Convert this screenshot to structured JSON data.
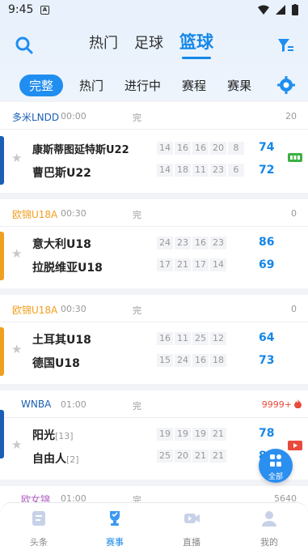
{
  "status_bar": {
    "time": "9:45",
    "sim_label": "A"
  },
  "header": {
    "main_tabs": [
      {
        "label": "热门",
        "active": false
      },
      {
        "label": "足球",
        "active": false
      },
      {
        "label": "篮球",
        "active": true
      }
    ],
    "sub_tabs": [
      {
        "label": "完整",
        "active": true
      },
      {
        "label": "热门",
        "active": false
      },
      {
        "label": "进行中",
        "active": false
      },
      {
        "label": "赛程",
        "active": false
      },
      {
        "label": "赛果",
        "active": false
      }
    ]
  },
  "matches": [
    {
      "league": "多米LNDD",
      "league_color": "#1a5fb4",
      "accent": "#1a5fb4",
      "time": "00:00",
      "status": "完",
      "count": "20",
      "home": {
        "name": "康斯蒂图延特斯U22",
        "rank": "",
        "quarters": [
          "14",
          "16",
          "16",
          "20",
          "8"
        ],
        "total": "74"
      },
      "away": {
        "name": "曹巴斯U22",
        "rank": "",
        "quarters": [
          "14",
          "18",
          "11",
          "23",
          "6"
        ],
        "total": "72"
      },
      "badge": "live-score-icon"
    },
    {
      "league": "欧锦U18A",
      "league_color": "#f0a020",
      "accent": "#f0a020",
      "time": "00:30",
      "status": "完",
      "count": "0",
      "home": {
        "name": "意大利U18",
        "rank": "",
        "quarters": [
          "24",
          "23",
          "16",
          "23"
        ],
        "total": "86"
      },
      "away": {
        "name": "拉脱维亚U18",
        "rank": "",
        "quarters": [
          "17",
          "21",
          "17",
          "14"
        ],
        "total": "69"
      }
    },
    {
      "league": "欧锦U18A",
      "league_color": "#f0a020",
      "accent": "#f0a020",
      "time": "00:30",
      "status": "完",
      "count": "0",
      "home": {
        "name": "土耳其U18",
        "rank": "",
        "quarters": [
          "16",
          "11",
          "25",
          "12"
        ],
        "total": "64"
      },
      "away": {
        "name": "德国U18",
        "rank": "",
        "quarters": [
          "15",
          "24",
          "16",
          "18"
        ],
        "total": "73"
      }
    },
    {
      "league": "WNBA",
      "league_color": "#1a5fb4",
      "accent": "#1a5fb4",
      "time": "01:00",
      "status": "完",
      "count": "9999+",
      "home": {
        "name": "阳光",
        "rank": "[13]",
        "quarters": [
          "19",
          "19",
          "19",
          "21"
        ],
        "total": "78"
      },
      "away": {
        "name": "自由人",
        "rank": "[2]",
        "quarters": [
          "25",
          "20",
          "21",
          "21"
        ],
        "total": "8"
      },
      "badge": "video-icon"
    }
  ],
  "next_match_peek": {
    "league": "欧女锦",
    "time": "01:00",
    "status": "完",
    "count": "5640"
  },
  "fab": {
    "label": "全部"
  },
  "bottom_nav": [
    {
      "label": "头条",
      "icon": "news-icon",
      "active": false
    },
    {
      "label": "赛事",
      "icon": "trophy-icon",
      "active": true
    },
    {
      "label": "直播",
      "icon": "live-icon",
      "active": false
    },
    {
      "label": "我的",
      "icon": "profile-icon",
      "active": false
    }
  ],
  "colors": {
    "accent": "#1487e8",
    "live_green": "#3cb043",
    "hot_red": "#e84a3c"
  }
}
